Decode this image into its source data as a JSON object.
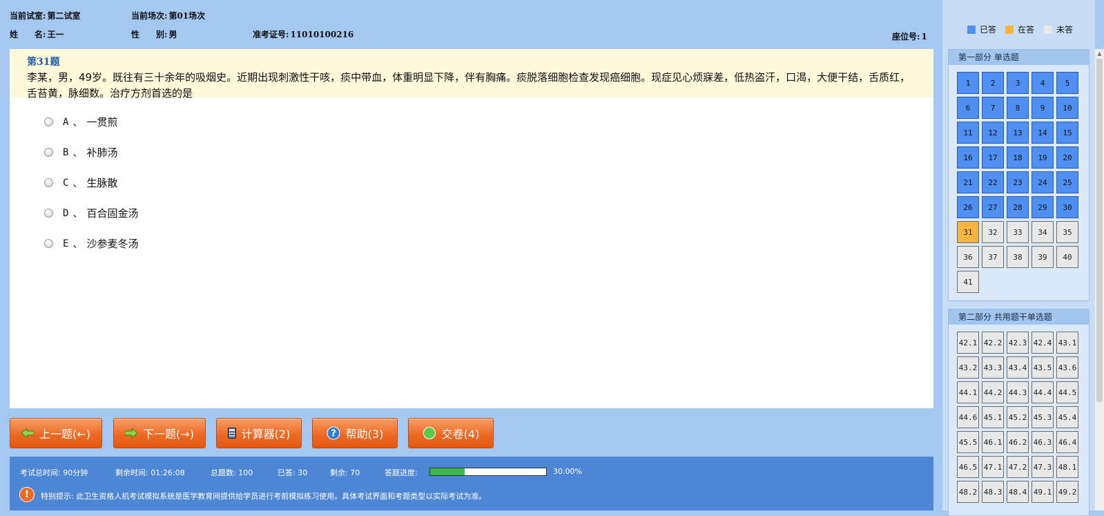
{
  "header": {
    "room_label": "当前试室:",
    "room_value": "第二试室",
    "session_label": "当前场次:",
    "session_value": "第01场次",
    "name_label": "姓　　名:",
    "name_value": "王一",
    "gender_label": "性　　别:",
    "gender_value": "男",
    "ticket_label": "准考证号:",
    "ticket_value": "11010100216",
    "seat_label": "座位号:",
    "seat_value": "1"
  },
  "question": {
    "number": "第31题",
    "text": "李某，男，49岁。既往有三十余年的吸烟史。近期出现刺激性干咳，痰中带血，体重明显下降，伴有胸痛。痰脱落细胞检查发现癌细胞。现症见心烦寐差，低热盗汗，口渴，大便干结，舌质红，舌苔黄，脉细数。治疗方剂首选的是",
    "options": [
      {
        "letter": "A",
        "sep": "、",
        "text": "一贯煎"
      },
      {
        "letter": "B",
        "sep": "、",
        "text": "补肺汤"
      },
      {
        "letter": "C",
        "sep": "、",
        "text": "生脉散"
      },
      {
        "letter": "D",
        "sep": "、",
        "text": "百合固金汤"
      },
      {
        "letter": "E",
        "sep": "、",
        "text": "沙参麦冬汤"
      }
    ]
  },
  "buttons": {
    "prev": "上一题(←)",
    "next": "下一题(→)",
    "calc": "计算器(2)",
    "help": "帮助(3)",
    "submit": "交卷(4)"
  },
  "footer": {
    "total_time": "考试总时间: 90分钟",
    "remaining_time": "剩余时间: 01:26:08",
    "total_count": "总题数: 100",
    "answered": "已答: 30",
    "remaining": "剩余: 70",
    "progress_label": "答题进度:",
    "progress_text": "30.00%",
    "progress_value": 0.3,
    "notice": "特别提示: 此卫生资格人机考试模拟系统是医学教育网提供给学员进行考前模拟练习使用。具体考试界面和考题类型以实际考试为准。"
  },
  "legend": {
    "answered": "已答",
    "current": "在答",
    "unanswered": "未答",
    "colors": {
      "answered": "#4f8ff2",
      "current": "#f7b53f",
      "unanswered": "#e8e8e8"
    }
  },
  "section1": {
    "title": "第一部分  单选题",
    "items": [
      "1",
      "2",
      "3",
      "4",
      "5",
      "6",
      "7",
      "8",
      "9",
      "10",
      "11",
      "12",
      "13",
      "14",
      "15",
      "16",
      "17",
      "18",
      "19",
      "20",
      "21",
      "22",
      "23",
      "24",
      "25",
      "26",
      "27",
      "28",
      "29",
      "30",
      "31",
      "32",
      "33",
      "34",
      "35",
      "36",
      "37",
      "38",
      "39",
      "40",
      "41"
    ],
    "answered_count": 30,
    "current": "31"
  },
  "section2": {
    "title": "第二部分  共用题干单选题",
    "items": [
      "42.1",
      "42.2",
      "42.3",
      "42.4",
      "43.1",
      "43.2",
      "43.3",
      "43.4",
      "43.5",
      "43.6",
      "44.1",
      "44.2",
      "44.3",
      "44.4",
      "44.5",
      "44.6",
      "45.1",
      "45.2",
      "45.3",
      "45.4",
      "45.5",
      "46.1",
      "46.2",
      "46.3",
      "46.4",
      "46.5",
      "47.1",
      "47.2",
      "47.3",
      "48.1",
      "48.2",
      "48.3",
      "48.4",
      "49.1",
      "49.2"
    ]
  }
}
